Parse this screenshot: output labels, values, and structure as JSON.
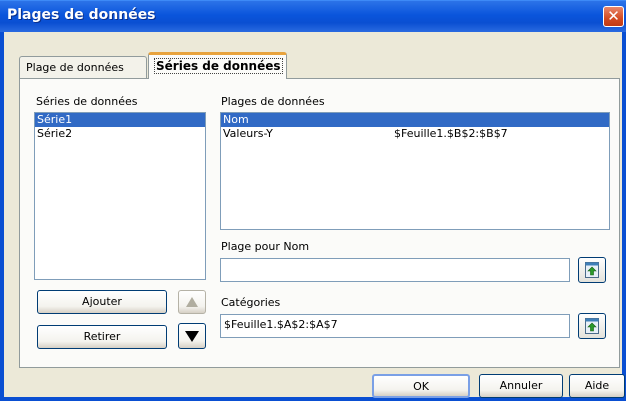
{
  "window": {
    "title": "Plages de données",
    "close_glyph": "✕"
  },
  "tabs": [
    {
      "label": "Plage de données",
      "active": false
    },
    {
      "label": "Séries de données",
      "active": true
    }
  ],
  "series_panel": {
    "label": "Séries de données",
    "items": [
      {
        "label": "Série1",
        "selected": true
      },
      {
        "label": "Série2",
        "selected": false
      }
    ]
  },
  "ranges_panel": {
    "label": "Plages de données",
    "rows": [
      {
        "role": "Nom",
        "range": "",
        "selected": true
      },
      {
        "role": "Valeurs-Y",
        "range": "$Feuille1.$B$2:$B$7",
        "selected": false
      }
    ]
  },
  "name_range": {
    "label": "Plage pour Nom",
    "value": "",
    "picker_icon": "range-picker-icon"
  },
  "categories": {
    "label": "Catégories",
    "value": "$Feuille1.$A$2:$A$7",
    "picker_icon": "range-picker-icon"
  },
  "buttons": {
    "add": "Ajouter",
    "remove": "Retirer",
    "move_up_icon": "arrow-up-icon",
    "move_down_icon": "arrow-down-icon",
    "ok": "OK",
    "cancel": "Annuler",
    "help": "Aide"
  },
  "colors": {
    "title_bar": "#0a55dc",
    "selection": "#316ac5",
    "dialog_bg": "#ece9d8",
    "active_tab_accent": "#e8a33d"
  }
}
